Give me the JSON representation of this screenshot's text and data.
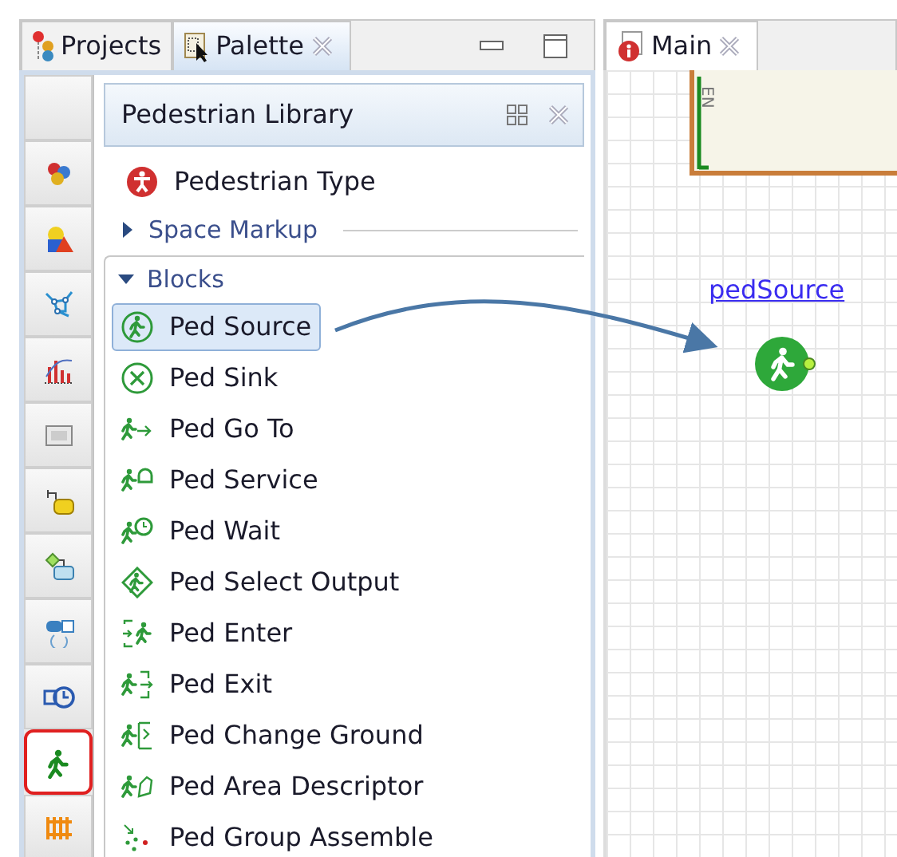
{
  "view_tabs": [
    {
      "label": "Projects",
      "selected": false,
      "closable": false
    },
    {
      "label": "Palette",
      "selected": true,
      "closable": true
    }
  ],
  "palette_tools": [
    {
      "selected": false
    },
    {
      "selected": false
    },
    {
      "selected": false
    },
    {
      "selected": false
    },
    {
      "selected": false
    },
    {
      "selected": false
    },
    {
      "selected": false
    },
    {
      "selected": false
    },
    {
      "selected": false
    },
    {
      "selected": false
    },
    {
      "selected": true
    },
    {
      "selected": false
    }
  ],
  "palette": {
    "title": "Pedestrian Library",
    "top_items": [
      {
        "label": "Pedestrian Type"
      }
    ],
    "sections": [
      {
        "label": "Space Markup",
        "expanded": false
      },
      {
        "label": "Blocks",
        "expanded": true,
        "items": [
          {
            "label": "Ped Source",
            "selected": true
          },
          {
            "label": "Ped Sink",
            "selected": false
          },
          {
            "label": "Ped Go To",
            "selected": false
          },
          {
            "label": "Ped Service",
            "selected": false
          },
          {
            "label": "Ped Wait",
            "selected": false
          },
          {
            "label": "Ped Select Output",
            "selected": false
          },
          {
            "label": "Ped Enter",
            "selected": false
          },
          {
            "label": "Ped Exit",
            "selected": false
          },
          {
            "label": "Ped Change Ground",
            "selected": false
          },
          {
            "label": "Ped Area Descriptor",
            "selected": false
          },
          {
            "label": "Ped Group Assemble",
            "selected": false
          }
        ]
      }
    ]
  },
  "editor": {
    "tabs": [
      {
        "label": "Main",
        "selected": true
      }
    ],
    "canvas_text": "EN",
    "block": {
      "name": "pedSource"
    }
  }
}
